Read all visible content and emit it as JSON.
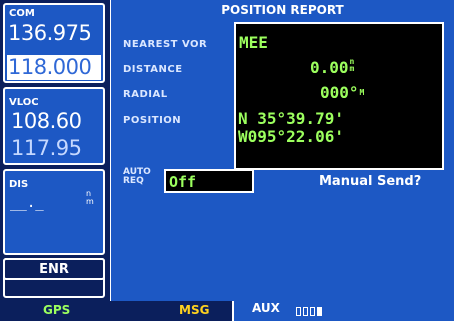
{
  "com": {
    "tag": "COM",
    "active": "136.975",
    "standby": "118.000"
  },
  "vloc": {
    "tag": "VLOC",
    "active": "108.60",
    "standby": "117.95"
  },
  "dis": {
    "tag": "DIS",
    "value": "__._",
    "unit_top": "n",
    "unit_bottom": "m"
  },
  "cdi": {
    "mode": "ENR"
  },
  "page": {
    "title": "POSITION REPORT",
    "nearest_vor_label": "NEAREST VOR",
    "nearest_vor_value": "MEE",
    "distance_label": "DISTANCE",
    "distance_value": "0.00",
    "distance_unit_top": "n",
    "distance_unit_bottom": "m",
    "radial_label": "RADIAL",
    "radial_value": "000°",
    "radial_unit": "M",
    "position_label": "POSITION",
    "latitude": "N 35°39.79'",
    "longitude": "W095°22.06'",
    "auto_label_line1": "AUTO",
    "auto_label_line2": "REQ",
    "auto_value": "Off",
    "manual_send": "Manual Send?"
  },
  "bottom_bar": {
    "gps": "GPS",
    "msg": "MSG",
    "aux": "AUX"
  },
  "colors": {
    "background_blue": "#1d58c4",
    "dark_navy": "#0b1f5c",
    "green_text": "#9cff5e",
    "msg_yellow": "#ffd21e"
  }
}
